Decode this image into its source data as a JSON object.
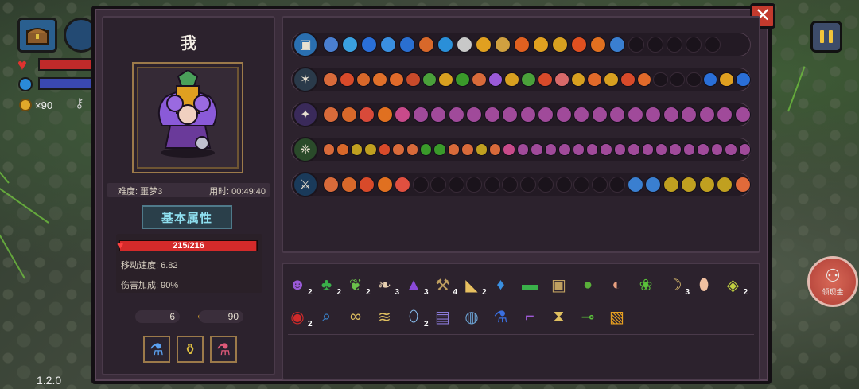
{
  "hud": {
    "coin_count": "×90",
    "version": "1.2.0"
  },
  "ad_button": {
    "label": "领现金"
  },
  "character": {
    "name": "我",
    "difficulty": "难度: 噩梦3",
    "elapsed": "用时: 00:49:40",
    "attributes_tab": "基本属性",
    "hp_text": "215/216",
    "hp_fraction": 0.995,
    "move_speed": "移动速度: 6.82",
    "damage_bonus": "伤害加成: 90%",
    "keys": "6",
    "coins": "90"
  },
  "slot_rows": [
    {
      "weapon_icon": "treasure-chest-icon",
      "weapon_color": "#2a6fb0",
      "icons": [
        "#4a7fd0",
        "#3aa0e0",
        "#2a6fd8",
        "#3a8fe0",
        "#2a6fd0",
        "#d8682a",
        "#2a8fd8",
        "#c8c8c8",
        "#e0a020",
        "#d0a040",
        "#e06020",
        "#e0a020",
        "#d8a020",
        "#e05020",
        "#e07020",
        "#3a7fd0"
      ],
      "empty": 5
    },
    {
      "weapon_icon": "staff-icon",
      "weapon_color": "#2a3a4a",
      "icons": [
        "#d86a3a",
        "#d84a2a",
        "#d8682a",
        "#e0702a",
        "#e06a2a",
        "#c84a2a",
        "#4aa03a",
        "#d8a020",
        "#3a9a2a",
        "#d86a3a",
        "#9a5ad8",
        "#d8a020",
        "#4aa03a",
        "#d84a2a",
        "#d86a6a",
        "#d8a020",
        "#e06a2a",
        "#d8a020",
        "#d84a2a",
        "#e06a2a"
      ],
      "empty": 3,
      "tail_icons": [
        "#2a6fd8",
        "#e0a020",
        "#2a6fd8"
      ]
    },
    {
      "weapon_icon": "wand-icon",
      "weapon_color": "#3a2a5a",
      "icons": [
        "#d86a3a",
        "#d8682a",
        "#d84a3a",
        "#e07020",
        "#c84a8a",
        "#a04a9a",
        "#a04a9a",
        "#a04a9a",
        "#a04a9a",
        "#a04a9a",
        "#a04a9a",
        "#a04a9a",
        "#a04a9a",
        "#a04a9a",
        "#a04a9a",
        "#a04a9a",
        "#a04a9a",
        "#a04a9a",
        "#a04a9a",
        "#a04a9a",
        "#a04a9a",
        "#a04a9a",
        "#a04a9a",
        "#a04a9a"
      ],
      "empty": 0
    },
    {
      "weapon_icon": "green-staff-icon",
      "weapon_color": "#2a4a2a",
      "icons": [
        "#d86a3a",
        "#d8682a",
        "#c0a020",
        "#c0a020",
        "#d84a2a",
        "#d86a3a",
        "#d86a3a",
        "#3a9a2a",
        "#3a9a2a",
        "#d86a3a",
        "#d86a3a",
        "#c0a020",
        "#d86a3a",
        "#c84a8a",
        "#a04a9a",
        "#a04a9a",
        "#a04a9a",
        "#a04a9a",
        "#a04a9a",
        "#a04a9a",
        "#a04a9a",
        "#a04a9a",
        "#a04a9a",
        "#a04a9a",
        "#a04a9a",
        "#a04a9a",
        "#a04a9a",
        "#a04a9a",
        "#a04a9a",
        "#a04a9a",
        "#a04a9a"
      ],
      "empty": 0
    },
    {
      "weapon_icon": "sword-icon",
      "weapon_color": "#1a3a5a",
      "icons": [
        "#d86a3a",
        "#d8682a",
        "#d84a2a",
        "#e07020",
        "#e05040"
      ],
      "empty": 12,
      "tail_icons": [
        "#3a7fd0",
        "#3a7fd0",
        "#c0a020",
        "#c0a020",
        "#c0a020",
        "#c0a020",
        "#e06a3a"
      ]
    }
  ],
  "items": [
    {
      "icon": "witch-portrait-icon",
      "color": "#9a5ad8",
      "glyph": "☻",
      "count": "2"
    },
    {
      "icon": "clover-icon",
      "color": "#3ab04a",
      "glyph": "♣",
      "count": "2"
    },
    {
      "icon": "leaves-icon",
      "color": "#6ac04a",
      "glyph": "❦",
      "count": "2"
    },
    {
      "icon": "feather-icon",
      "color": "#e8d0b0",
      "glyph": "❧",
      "count": "3"
    },
    {
      "icon": "witch-hat-icon",
      "color": "#8a4ad8",
      "glyph": "▲",
      "count": "3"
    },
    {
      "icon": "pickaxe-icon",
      "color": "#c0a060",
      "glyph": "⚒",
      "count": "4"
    },
    {
      "icon": "horn-icon",
      "color": "#e8c060",
      "glyph": "◣",
      "count": "2"
    },
    {
      "icon": "lantern-icon",
      "color": "#3a8fe0",
      "glyph": "♦",
      "count": ""
    },
    {
      "icon": "belt-icon",
      "color": "#3ab04a",
      "glyph": "▬",
      "count": ""
    },
    {
      "icon": "book-icon",
      "color": "#c0a060",
      "glyph": "▣",
      "count": ""
    },
    {
      "icon": "green-orb-icon",
      "color": "#5ab03a",
      "glyph": "●",
      "count": ""
    },
    {
      "icon": "meat-icon",
      "color": "#e8a080",
      "glyph": "◐",
      "count": ""
    },
    {
      "icon": "sprout-icon",
      "color": "#5ac03a",
      "glyph": "❀",
      "count": ""
    },
    {
      "icon": "crescent-icon",
      "color": "#e0c070",
      "glyph": "☽",
      "count": "3"
    },
    {
      "icon": "egg-icon",
      "color": "#f0c0a0",
      "glyph": "⬮",
      "count": ""
    },
    {
      "icon": "gem-box-icon",
      "color": "#c0d040",
      "glyph": "◈",
      "count": "2"
    },
    {
      "icon": "red-eye-icon",
      "color": "#d02a2a",
      "glyph": "◉",
      "count": "2"
    },
    {
      "icon": "magnifier-icon",
      "color": "#3a8fe0",
      "glyph": "⌕",
      "count": ""
    },
    {
      "icon": "glasses-icon",
      "color": "#e0c060",
      "glyph": "∞",
      "count": ""
    },
    {
      "icon": "comb-icon",
      "color": "#e0c060",
      "glyph": "≋",
      "count": ""
    },
    {
      "icon": "mirror-icon",
      "color": "#8ac0f0",
      "glyph": "⬯",
      "count": "2"
    },
    {
      "icon": "scroll-icon",
      "color": "#8a7ad8",
      "glyph": "▤",
      "count": ""
    },
    {
      "icon": "globe-icon",
      "color": "#6aa0d0",
      "glyph": "◍",
      "count": ""
    },
    {
      "icon": "blue-potion-icon",
      "color": "#3a6fe0",
      "glyph": "⚗",
      "count": ""
    },
    {
      "icon": "boot-icon",
      "color": "#a05ad8",
      "glyph": "⌐",
      "count": ""
    },
    {
      "icon": "hourglass-icon",
      "color": "#e0c060",
      "glyph": "⧗",
      "count": ""
    },
    {
      "icon": "syringe-icon",
      "color": "#5ac03a",
      "glyph": "⊸",
      "count": ""
    },
    {
      "icon": "ticket-icon",
      "color": "#e8a020",
      "glyph": "▧",
      "count": ""
    }
  ]
}
